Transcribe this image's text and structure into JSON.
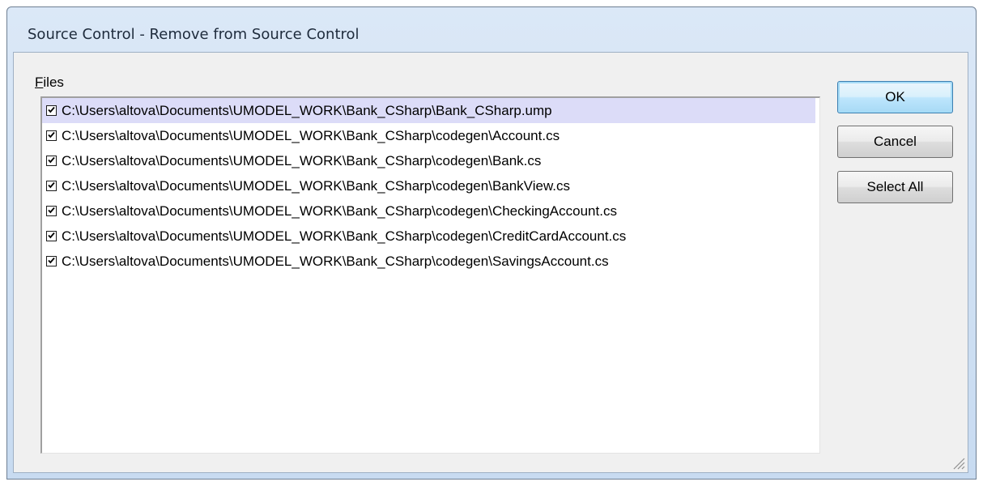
{
  "window": {
    "title": "Source Control - Remove from Source Control"
  },
  "files": {
    "label_mnemonic": "F",
    "label_rest": "iles",
    "items": [
      {
        "checked": true,
        "path": "C:\\Users\\altova\\Documents\\UMODEL_WORK\\Bank_CSharp\\Bank_CSharp.ump"
      },
      {
        "checked": true,
        "path": "C:\\Users\\altova\\Documents\\UMODEL_WORK\\Bank_CSharp\\codegen\\Account.cs"
      },
      {
        "checked": true,
        "path": "C:\\Users\\altova\\Documents\\UMODEL_WORK\\Bank_CSharp\\codegen\\Bank.cs"
      },
      {
        "checked": true,
        "path": "C:\\Users\\altova\\Documents\\UMODEL_WORK\\Bank_CSharp\\codegen\\BankView.cs"
      },
      {
        "checked": true,
        "path": "C:\\Users\\altova\\Documents\\UMODEL_WORK\\Bank_CSharp\\codegen\\CheckingAccount.cs"
      },
      {
        "checked": true,
        "path": "C:\\Users\\altova\\Documents\\UMODEL_WORK\\Bank_CSharp\\codegen\\CreditCardAccount.cs"
      },
      {
        "checked": true,
        "path": "C:\\Users\\altova\\Documents\\UMODEL_WORK\\Bank_CSharp\\codegen\\SavingsAccount.cs"
      }
    ]
  },
  "buttons": {
    "ok_label": "OK",
    "cancel_label": "Cancel",
    "select_all_label": "Select All"
  },
  "icons": {
    "checkbox_tick": "checkmark-icon",
    "resize_grip": "resize-grip-icon"
  },
  "colors": {
    "selection": "#dcdcf8",
    "default_button": "#bee6fd"
  }
}
